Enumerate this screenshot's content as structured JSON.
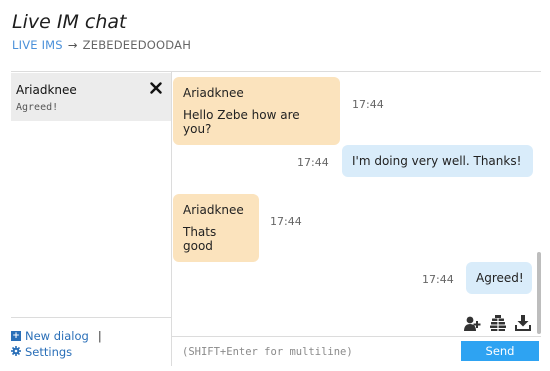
{
  "header": {
    "title": "Live IM chat",
    "breadcrumb": {
      "link": "LIVE IMS",
      "arrow": "→",
      "current": "ZEBEDEEDOODAH"
    }
  },
  "sidebar": {
    "dialogs": [
      {
        "name": "Ariadknee",
        "preview": "Agreed!",
        "close": "✕"
      }
    ],
    "footer": {
      "new_dialog": "New dialog",
      "separator": "|",
      "settings": "Settings"
    }
  },
  "chat": {
    "messages": [
      {
        "direction": "in",
        "sender": "Ariadknee",
        "text": "Hello Zebe how are you?",
        "time": "17:44"
      },
      {
        "direction": "out",
        "text": "I'm doing very well. Thanks!",
        "time": "17:44"
      },
      {
        "direction": "in",
        "sender": "Ariadknee",
        "text": "Thats good",
        "time": "17:44"
      },
      {
        "direction": "out",
        "text": "Agreed!",
        "time": "17:44"
      }
    ],
    "tools": [
      "add-user-icon",
      "archive-icon",
      "download-icon"
    ]
  },
  "composer": {
    "placeholder": "(SHIFT+Enter for multiline)",
    "send_label": "Send"
  },
  "colors": {
    "incoming_bubble": "#fbe3bd",
    "outgoing_bubble": "#d9ecfa",
    "send_button": "#2ea3f2",
    "link": "#4a90d9"
  }
}
